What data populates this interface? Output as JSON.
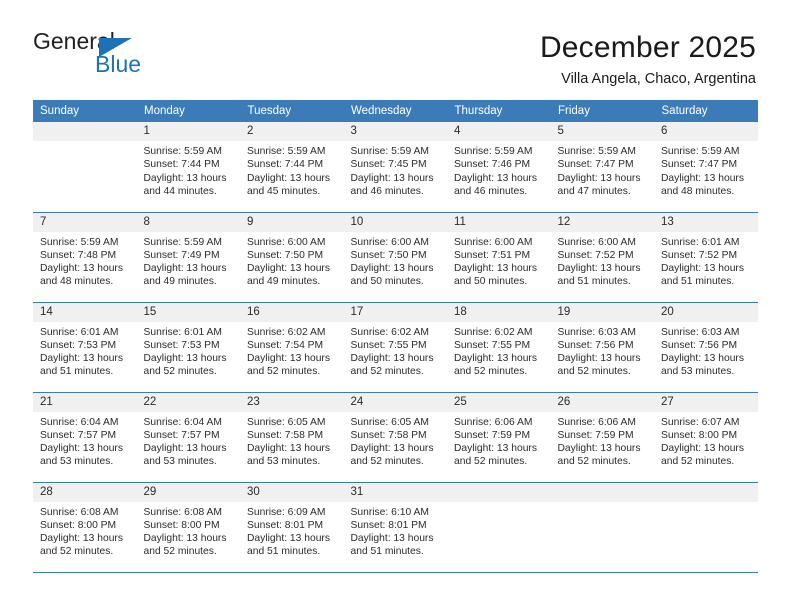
{
  "logo": {
    "word_one": "General",
    "word_two": "Blue",
    "triangle_color": "#1d71b8"
  },
  "header": {
    "title": "December 2025",
    "subtitle": "Villa Angela, Chaco, Argentina"
  },
  "theme": {
    "header_blue": "#3b7cb8",
    "daynum_gray": "#f0f0f0",
    "text": "#2b2b2b"
  },
  "calendar": {
    "weekday_headers": [
      "Sunday",
      "Monday",
      "Tuesday",
      "Wednesday",
      "Thursday",
      "Friday",
      "Saturday"
    ],
    "weeks": [
      [
        {
          "day": "",
          "lines": []
        },
        {
          "day": "1",
          "lines": [
            "Sunrise: 5:59 AM",
            "Sunset: 7:44 PM",
            "Daylight: 13 hours",
            "and 44 minutes."
          ]
        },
        {
          "day": "2",
          "lines": [
            "Sunrise: 5:59 AM",
            "Sunset: 7:44 PM",
            "Daylight: 13 hours",
            "and 45 minutes."
          ]
        },
        {
          "day": "3",
          "lines": [
            "Sunrise: 5:59 AM",
            "Sunset: 7:45 PM",
            "Daylight: 13 hours",
            "and 46 minutes."
          ]
        },
        {
          "day": "4",
          "lines": [
            "Sunrise: 5:59 AM",
            "Sunset: 7:46 PM",
            "Daylight: 13 hours",
            "and 46 minutes."
          ]
        },
        {
          "day": "5",
          "lines": [
            "Sunrise: 5:59 AM",
            "Sunset: 7:47 PM",
            "Daylight: 13 hours",
            "and 47 minutes."
          ]
        },
        {
          "day": "6",
          "lines": [
            "Sunrise: 5:59 AM",
            "Sunset: 7:47 PM",
            "Daylight: 13 hours",
            "and 48 minutes."
          ]
        }
      ],
      [
        {
          "day": "7",
          "lines": [
            "Sunrise: 5:59 AM",
            "Sunset: 7:48 PM",
            "Daylight: 13 hours",
            "and 48 minutes."
          ]
        },
        {
          "day": "8",
          "lines": [
            "Sunrise: 5:59 AM",
            "Sunset: 7:49 PM",
            "Daylight: 13 hours",
            "and 49 minutes."
          ]
        },
        {
          "day": "9",
          "lines": [
            "Sunrise: 6:00 AM",
            "Sunset: 7:50 PM",
            "Daylight: 13 hours",
            "and 49 minutes."
          ]
        },
        {
          "day": "10",
          "lines": [
            "Sunrise: 6:00 AM",
            "Sunset: 7:50 PM",
            "Daylight: 13 hours",
            "and 50 minutes."
          ]
        },
        {
          "day": "11",
          "lines": [
            "Sunrise: 6:00 AM",
            "Sunset: 7:51 PM",
            "Daylight: 13 hours",
            "and 50 minutes."
          ]
        },
        {
          "day": "12",
          "lines": [
            "Sunrise: 6:00 AM",
            "Sunset: 7:52 PM",
            "Daylight: 13 hours",
            "and 51 minutes."
          ]
        },
        {
          "day": "13",
          "lines": [
            "Sunrise: 6:01 AM",
            "Sunset: 7:52 PM",
            "Daylight: 13 hours",
            "and 51 minutes."
          ]
        }
      ],
      [
        {
          "day": "14",
          "lines": [
            "Sunrise: 6:01 AM",
            "Sunset: 7:53 PM",
            "Daylight: 13 hours",
            "and 51 minutes."
          ]
        },
        {
          "day": "15",
          "lines": [
            "Sunrise: 6:01 AM",
            "Sunset: 7:53 PM",
            "Daylight: 13 hours",
            "and 52 minutes."
          ]
        },
        {
          "day": "16",
          "lines": [
            "Sunrise: 6:02 AM",
            "Sunset: 7:54 PM",
            "Daylight: 13 hours",
            "and 52 minutes."
          ]
        },
        {
          "day": "17",
          "lines": [
            "Sunrise: 6:02 AM",
            "Sunset: 7:55 PM",
            "Daylight: 13 hours",
            "and 52 minutes."
          ]
        },
        {
          "day": "18",
          "lines": [
            "Sunrise: 6:02 AM",
            "Sunset: 7:55 PM",
            "Daylight: 13 hours",
            "and 52 minutes."
          ]
        },
        {
          "day": "19",
          "lines": [
            "Sunrise: 6:03 AM",
            "Sunset: 7:56 PM",
            "Daylight: 13 hours",
            "and 52 minutes."
          ]
        },
        {
          "day": "20",
          "lines": [
            "Sunrise: 6:03 AM",
            "Sunset: 7:56 PM",
            "Daylight: 13 hours",
            "and 53 minutes."
          ]
        }
      ],
      [
        {
          "day": "21",
          "lines": [
            "Sunrise: 6:04 AM",
            "Sunset: 7:57 PM",
            "Daylight: 13 hours",
            "and 53 minutes."
          ]
        },
        {
          "day": "22",
          "lines": [
            "Sunrise: 6:04 AM",
            "Sunset: 7:57 PM",
            "Daylight: 13 hours",
            "and 53 minutes."
          ]
        },
        {
          "day": "23",
          "lines": [
            "Sunrise: 6:05 AM",
            "Sunset: 7:58 PM",
            "Daylight: 13 hours",
            "and 53 minutes."
          ]
        },
        {
          "day": "24",
          "lines": [
            "Sunrise: 6:05 AM",
            "Sunset: 7:58 PM",
            "Daylight: 13 hours",
            "and 52 minutes."
          ]
        },
        {
          "day": "25",
          "lines": [
            "Sunrise: 6:06 AM",
            "Sunset: 7:59 PM",
            "Daylight: 13 hours",
            "and 52 minutes."
          ]
        },
        {
          "day": "26",
          "lines": [
            "Sunrise: 6:06 AM",
            "Sunset: 7:59 PM",
            "Daylight: 13 hours",
            "and 52 minutes."
          ]
        },
        {
          "day": "27",
          "lines": [
            "Sunrise: 6:07 AM",
            "Sunset: 8:00 PM",
            "Daylight: 13 hours",
            "and 52 minutes."
          ]
        }
      ],
      [
        {
          "day": "28",
          "lines": [
            "Sunrise: 6:08 AM",
            "Sunset: 8:00 PM",
            "Daylight: 13 hours",
            "and 52 minutes."
          ]
        },
        {
          "day": "29",
          "lines": [
            "Sunrise: 6:08 AM",
            "Sunset: 8:00 PM",
            "Daylight: 13 hours",
            "and 52 minutes."
          ]
        },
        {
          "day": "30",
          "lines": [
            "Sunrise: 6:09 AM",
            "Sunset: 8:01 PM",
            "Daylight: 13 hours",
            "and 51 minutes."
          ]
        },
        {
          "day": "31",
          "lines": [
            "Sunrise: 6:10 AM",
            "Sunset: 8:01 PM",
            "Daylight: 13 hours",
            "and 51 minutes."
          ]
        },
        {
          "day": "",
          "lines": []
        },
        {
          "day": "",
          "lines": []
        },
        {
          "day": "",
          "lines": []
        }
      ]
    ]
  }
}
